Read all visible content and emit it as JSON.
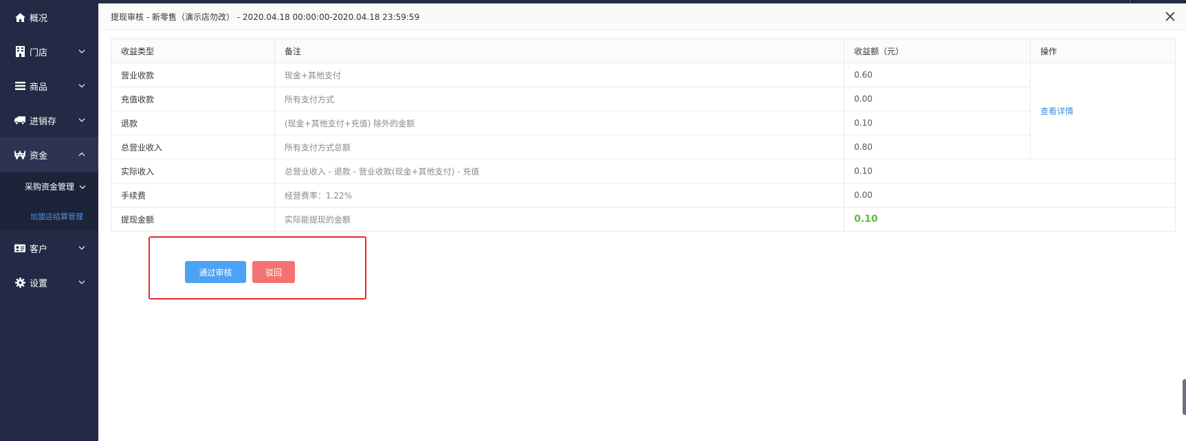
{
  "sidebar": {
    "items": [
      {
        "label": "概况",
        "icon": "home-icon"
      },
      {
        "label": "门店",
        "icon": "building-icon"
      },
      {
        "label": "商品",
        "icon": "list-icon"
      },
      {
        "label": "进销存",
        "icon": "truck-icon"
      },
      {
        "label": "资金",
        "icon": "won-icon"
      },
      {
        "label": "客户",
        "icon": "id-card-icon"
      },
      {
        "label": "设置",
        "icon": "gear-icon"
      }
    ],
    "sub_menu": {
      "label": "采购资金管理",
      "child": "加盟店结算管理"
    }
  },
  "modal": {
    "title": "提现审核 - 新零售（演示店勿改） - 2020.04.18 00:00:00-2020.04.18 23:59:59",
    "table": {
      "headers": [
        "收益类型",
        "备注",
        "收益额（元）",
        "操作"
      ],
      "rows": [
        {
          "type": "营业收款",
          "note": "现金+其他支付",
          "amount": "0.60"
        },
        {
          "type": "充值收款",
          "note": "所有支付方式",
          "amount": "0.00"
        },
        {
          "type": "退款",
          "note": "(现金+其他支付+充值) 除外的金额",
          "amount": "0.10"
        },
        {
          "type": "总营业收入",
          "note": "所有支付方式总额",
          "amount": "0.80"
        },
        {
          "type": "实际收入",
          "note": "总营业收入 - 退款 - 营业收款(现金+其他支付) - 充值",
          "amount": "0.10"
        },
        {
          "type": "手续费",
          "note": "经营费率：1.22%",
          "amount": "0.00"
        },
        {
          "type": "提现金额",
          "note": "实际能提现的金额",
          "amount": "0.10"
        }
      ],
      "detail_link": "查看详情"
    },
    "buttons": {
      "pass": "通过审核",
      "reject": "驳回"
    }
  },
  "colors": {
    "sidebar_bg": "#232a45",
    "accent_blue": "#4ca3f5",
    "reject_red": "#f57272",
    "total_green": "#5dbd3a",
    "highlight_red": "#e8262b"
  }
}
